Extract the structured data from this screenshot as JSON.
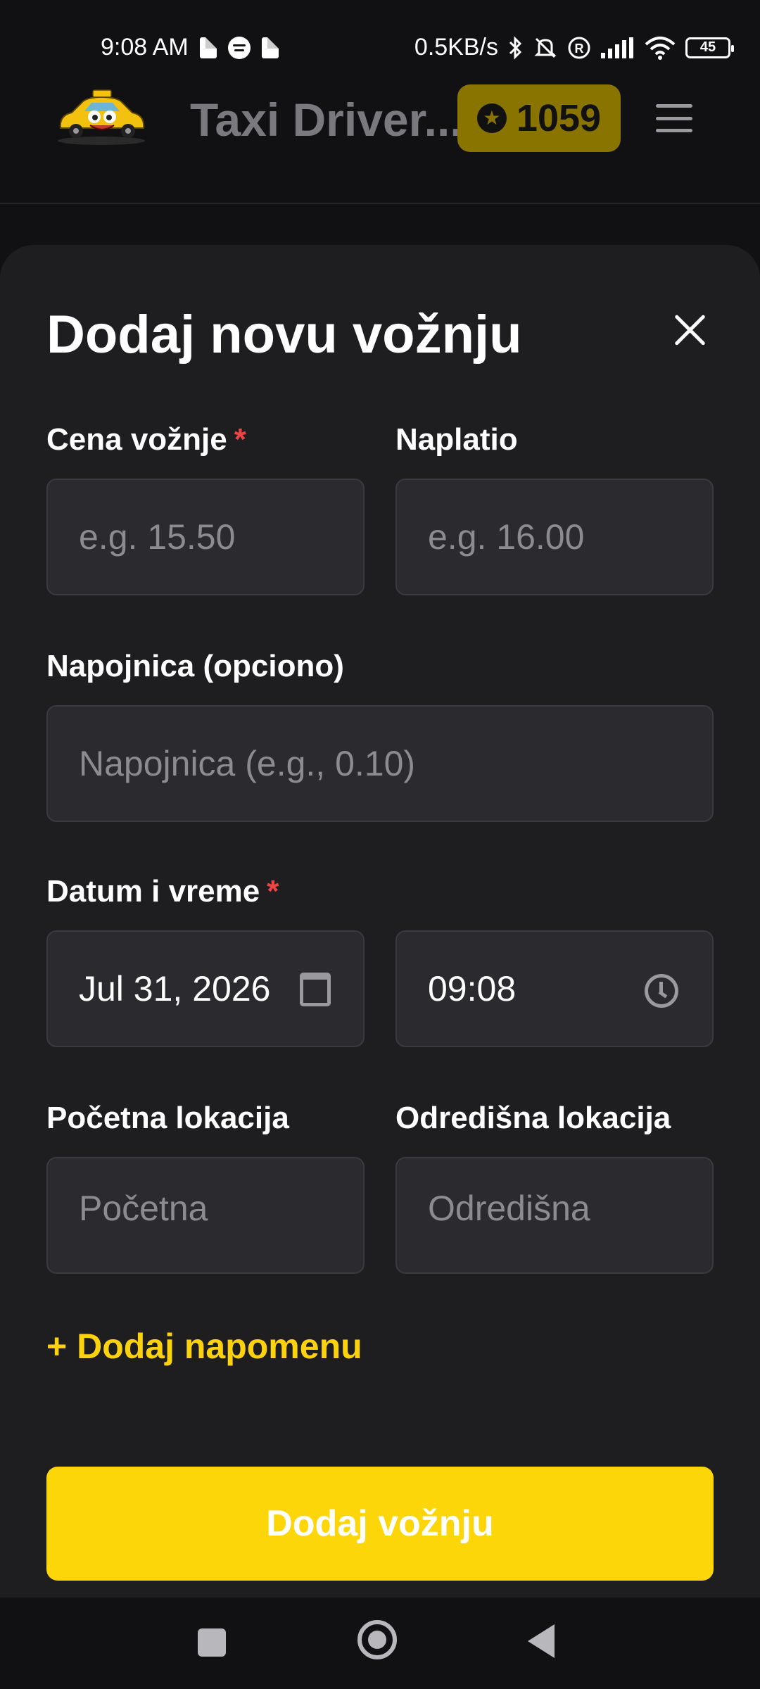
{
  "status_bar": {
    "time": "9:08 AM",
    "network_speed": "0.5KB/s",
    "battery": "45",
    "icons": [
      "pdf-file-icon",
      "spotify-icon",
      "pdf-file-icon",
      "bluetooth-icon",
      "mute-bell-icon",
      "registered-icon",
      "signal-icon",
      "wifi-icon",
      "battery-icon"
    ]
  },
  "header": {
    "app_title": "Taxi Driver...",
    "coins": "1059",
    "coin_icon": "star-icon",
    "menu_icon": "hamburger-menu-icon"
  },
  "form": {
    "title": "Dodaj novu vožnju",
    "close_icon": "close-icon",
    "required_marker": "*",
    "price": {
      "label": "Cena vožnje",
      "placeholder": "e.g. 15.50"
    },
    "charged": {
      "label": "Naplatio",
      "placeholder": "e.g. 16.00"
    },
    "tip": {
      "label": "Napojnica (opciono)",
      "placeholder": "Napojnica (e.g., 0.10)"
    },
    "datetime": {
      "label": "Datum i vreme",
      "date_value": "Jul 31, 2026",
      "time_value": "09:08"
    },
    "start_location": {
      "label": "Početna lokacija",
      "placeholder": "Početna"
    },
    "destination": {
      "label": "Odredišna lokacija",
      "placeholder": "Odredišna"
    },
    "add_note": "+ Dodaj napomenu",
    "submit": "Dodaj vožnju"
  },
  "colors": {
    "accent_yellow": "#fcd609",
    "required_red": "#ef4444",
    "sheet_bg": "#1e1e21",
    "field_bg": "#2b2b2f"
  }
}
